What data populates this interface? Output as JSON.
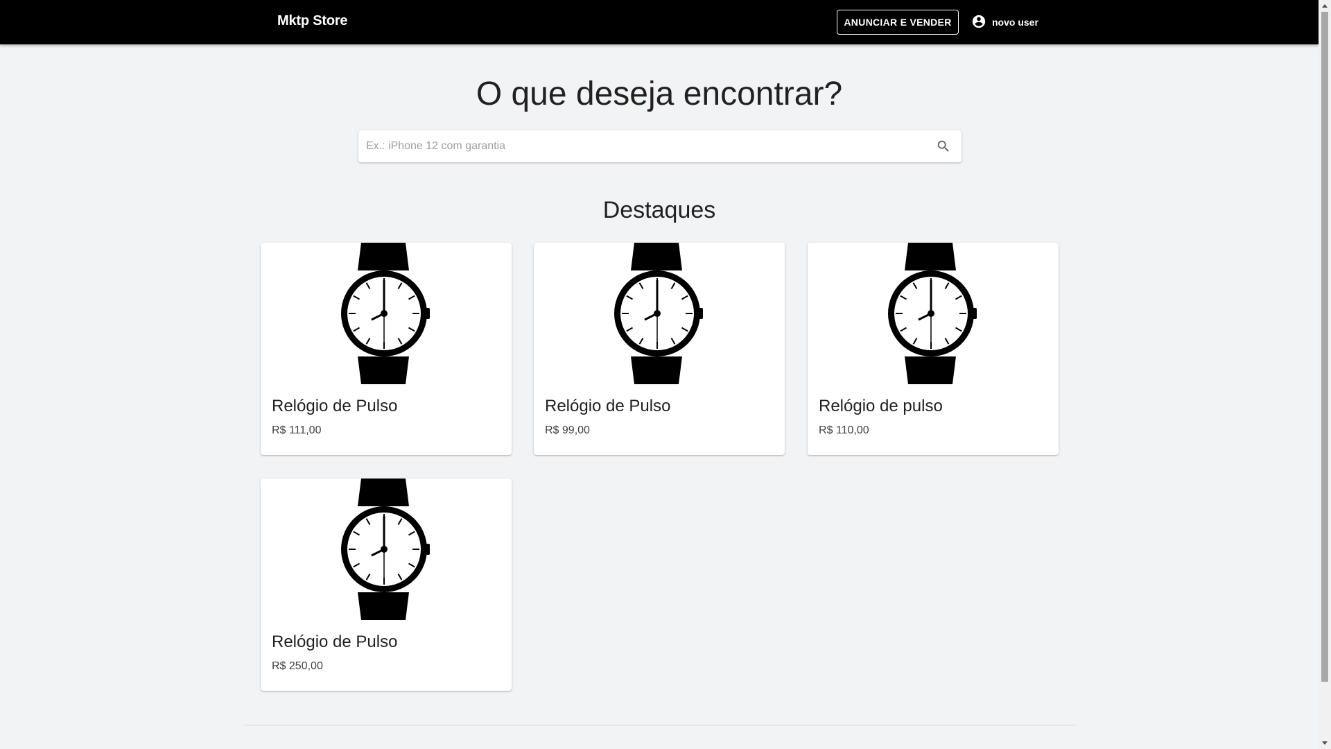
{
  "header": {
    "brand": "Mktp Store",
    "sell_button": "ANUNCIAR E VENDER",
    "user_name": "novo user"
  },
  "hero": {
    "title": "O que deseja encontrar?",
    "search_placeholder": "Ex.: iPhone 12 com garantia",
    "search_value": ""
  },
  "featured": {
    "title": "Destaques",
    "products": [
      {
        "name": "Relógio de Pulso",
        "price": "R$ 111,00",
        "image_icon": "wristwatch-icon"
      },
      {
        "name": "Relógio de Pulso",
        "price": "R$ 99,00",
        "image_icon": "wristwatch-icon"
      },
      {
        "name": "Relógio de pulso",
        "price": "R$ 110,00",
        "image_icon": "wristwatch-icon"
      },
      {
        "name": "Relógio de Pulso",
        "price": "R$ 250,00",
        "image_icon": "wristwatch-icon"
      }
    ]
  },
  "colors": {
    "header_bg": "#000000",
    "page_bg": "#f2f3f5",
    "card_bg": "#ffffff"
  }
}
